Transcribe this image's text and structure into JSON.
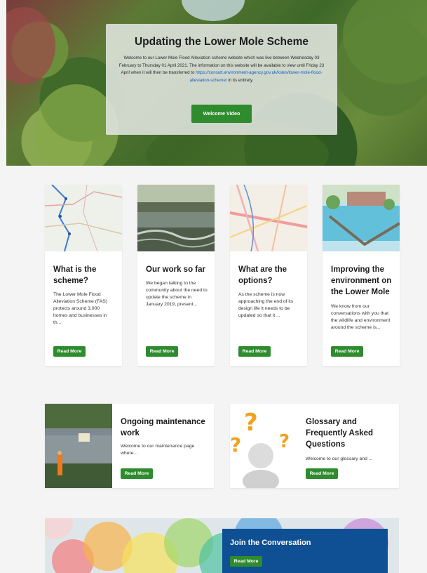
{
  "hero": {
    "title": "Updating the Lower Mole Scheme",
    "desc_text": "Welcome to our Lower Mole Flood Alleviation scheme website which was live between Wednesday 03 February to Thursday 01 April 2021. The information on this website will be available to view until Friday 23 April when it will then be transferred to ",
    "desc_link": "https://consult.environment-agency.gov.uk/ksles/lower-mole-flood-alleviation-scheme/",
    "desc_end": " in its entirety.",
    "button": "Welcome Video"
  },
  "cards": [
    {
      "title": "What is the scheme?",
      "text": "The Lower Mole Flood Alleviation Scheme (FAS) protects around 3,000 homes and businesses in th...",
      "button": "Read More"
    },
    {
      "title": "Our work so far",
      "text": "We began talking to the community about the need to update the scheme in January 2019, present...",
      "button": "Read More"
    },
    {
      "title": "What are the options?",
      "text": "As the scheme is now approaching the end of its design life it needs to be updated so that it ...",
      "button": "Read More"
    },
    {
      "title": "Improving the environment on the Lower Mole",
      "text": "We know from our conversations with you that the wildlife and environment around the scheme is...",
      "button": "Read More"
    }
  ],
  "wide_cards": [
    {
      "title": "Ongoing maintenance work",
      "text": "Welcome to our maintenance page where...",
      "button": "Read More"
    },
    {
      "title": "Glossary and Frequently Asked Questions",
      "text": "Welcome to our glossary and ...",
      "button": "Read More"
    }
  ],
  "join": {
    "title": "Join the Conversation",
    "button": "Read More"
  },
  "colors": {
    "accent_green": "#2e8b2e",
    "join_blue": "#0f4f93",
    "link_blue": "#1a5fc7"
  }
}
